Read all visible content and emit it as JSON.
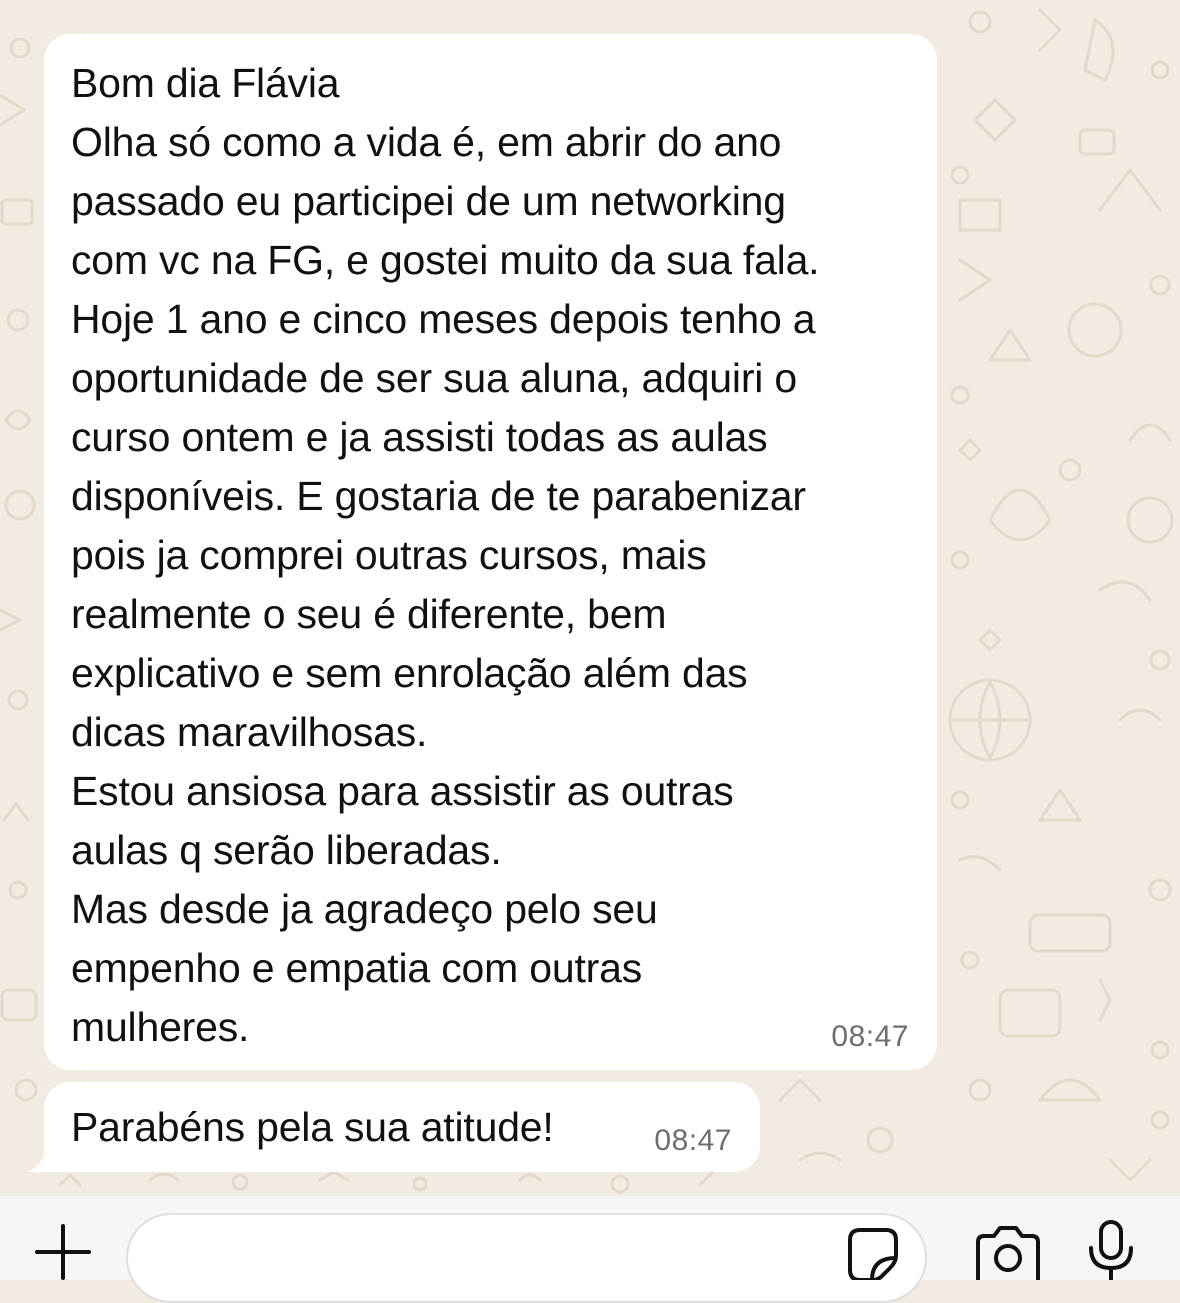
{
  "chat": {
    "messages": [
      {
        "text": "Bom dia Flávia\nOlha só como a vida é, em abrir do ano\npassado eu participei de um networking\ncom vc na FG, e gostei muito da sua fala.\nHoje 1 ano e cinco meses depois tenho a\noportunidade de ser sua aluna, adquiri o\ncurso ontem e ja assisti todas as aulas\ndisponíveis. E gostaria de te parabenizar\npois ja comprei outras cursos, mais\nrealmente o seu é diferente, bem\nexplicativo e sem enrolação além das\ndicas maravilhosas.\nEstou ansiosa para assistir as outras\naulas q serão liberadas.\nMas desde ja agradeço pelo seu\nempenho e empatia com outras\nmulheres.",
        "time": "08:47"
      },
      {
        "text": "Parabéns pela sua atitude!",
        "time": "08:47"
      }
    ]
  },
  "input_bar": {
    "message_value": "",
    "icons": {
      "attach": "plus-icon",
      "sticker": "sticker-icon",
      "camera": "camera-icon",
      "voice": "microphone-icon"
    }
  },
  "colors": {
    "wallpaper": "#f1ebe1",
    "wallpaper_doodle": "#e2d9cb",
    "bubble": "#ffffff",
    "text": "#111111",
    "timestamp": "#6e6e6e",
    "icon": "#111111"
  }
}
